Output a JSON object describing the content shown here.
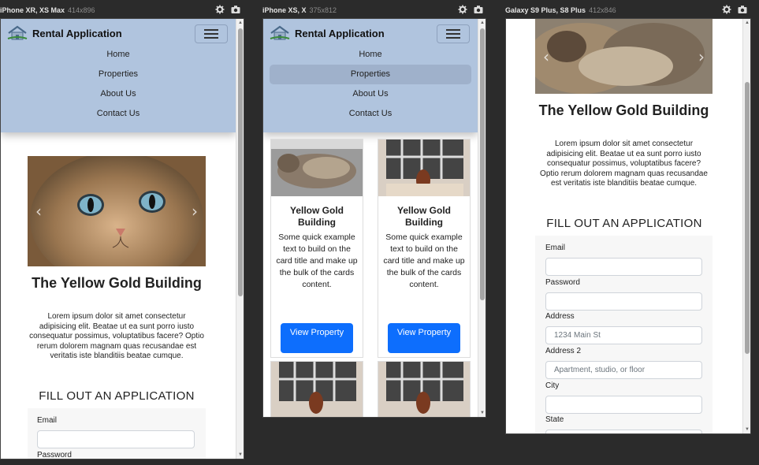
{
  "devices": [
    {
      "name": "iPhone XR, XS Max",
      "size": "414x896"
    },
    {
      "name": "iPhone XS, X",
      "size": "375x812"
    },
    {
      "name": "Galaxy S9 Plus, S8 Plus",
      "size": "412x846"
    }
  ],
  "navbar": {
    "brand": "Rental Application",
    "links": [
      "Home",
      "Properties",
      "About Us",
      "Contact Us"
    ],
    "active": "Properties"
  },
  "property": {
    "title": "The Yellow Gold Building",
    "description": "Lorem ipsum dolor sit amet consectetur adipisicing elit. Beatae ut ea sunt porro iusto consequatur possimus, voluptatibus facere? Optio rerum dolorem magnam quas recusandae est veritatis iste blanditiis beatae cumque."
  },
  "form": {
    "heading": "FILL OUT AN APPLICATION",
    "email_label": "Email",
    "password_label": "Password",
    "address_label": "Address",
    "address_placeholder": "1234 Main St",
    "address2_label": "Address 2",
    "address2_placeholder": "Apartment, studio, or floor",
    "city_label": "City",
    "state_label": "State"
  },
  "cards": [
    {
      "title": "Yellow Gold Building",
      "text": "Some quick example text to build on the card title and make up the bulk of the cards content.",
      "button": "View Property"
    },
    {
      "title": "Yellow Gold Building",
      "text": "Some quick example text to build on the card title and make up the bulk of the cards content.",
      "button": "View Property"
    }
  ],
  "colors": {
    "navbar": "#b0c4de",
    "button": "#0d6efd",
    "background": "#2b2b2b"
  }
}
